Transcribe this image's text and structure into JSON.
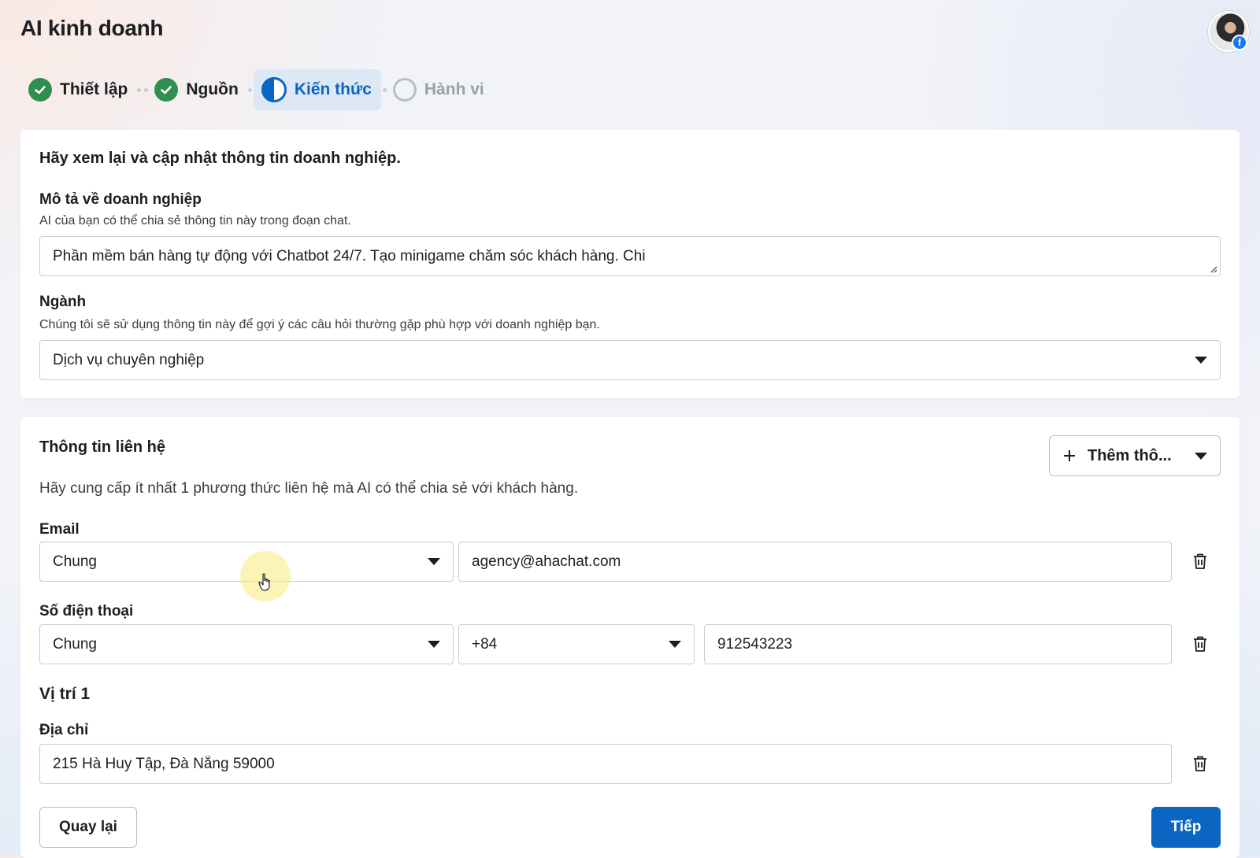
{
  "header": {
    "title": "AI kinh doanh"
  },
  "steps": [
    {
      "label": "Thiết lập",
      "state": "done"
    },
    {
      "label": "Nguồn",
      "state": "done"
    },
    {
      "label": "Kiến thức",
      "state": "current"
    },
    {
      "label": "Hành vi",
      "state": "todo"
    }
  ],
  "business": {
    "heading": "Hãy xem lại và cập nhật thông tin doanh nghiệp.",
    "description": {
      "label": "Mô tả về doanh nghiệp",
      "help": "AI của bạn có thể chia sẻ thông tin này trong đoạn chat.",
      "value": "Phần mềm bán hàng tự động với Chatbot 24/7. Tạo minigame chăm sóc khách hàng. Chi"
    },
    "industry": {
      "label": "Ngành",
      "help": "Chúng tôi sẽ sử dụng thông tin này để gợi ý các câu hỏi thường gặp phù hợp với doanh nghiệp bạn.",
      "value": "Dịch vụ chuyên nghiệp"
    }
  },
  "contact": {
    "heading": "Thông tin liên hệ",
    "add_button": "Thêm thô...",
    "help": "Hãy cung cấp ít nhất 1 phương thức liên hệ mà AI có thể chia sẻ với khách hàng.",
    "email": {
      "label": "Email",
      "type": "Chung",
      "value": "agency@ahachat.com"
    },
    "phone": {
      "label": "Số điện thoại",
      "type": "Chung",
      "country_code": "+84",
      "value": "912543223"
    },
    "location": {
      "heading": "Vị trí 1",
      "label": "Địa chỉ",
      "value": "215 Hà Huy Tập, Đà Nẵng 59000"
    }
  },
  "footer": {
    "back": "Quay lại",
    "next": "Tiếp"
  },
  "colors": {
    "primary": "#0a66c2",
    "success": "#2f8f4e",
    "step_active_bg": "#dce8f6"
  }
}
